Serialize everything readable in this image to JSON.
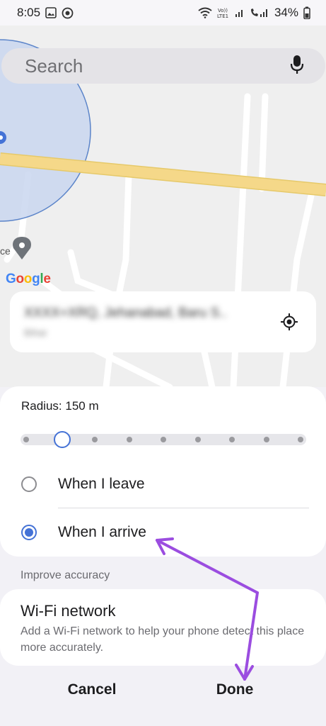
{
  "status_bar": {
    "time": "8:05",
    "battery": "34%"
  },
  "search": {
    "placeholder": "Search"
  },
  "map": {
    "attribution_letters": [
      "G",
      "o",
      "o",
      "g",
      "l",
      "e"
    ],
    "place_label_fragment": "ce"
  },
  "address_card": {
    "line1": "XXXX+XRQ, Jehanabad, Baru S..",
    "line2": "Bihar"
  },
  "radius": {
    "label": "Radius: 150 m",
    "steps": 9,
    "selected_step": 1
  },
  "trigger_options": [
    {
      "label": "When I leave",
      "selected": false
    },
    {
      "label": "When I arrive",
      "selected": true
    }
  ],
  "accuracy": {
    "heading": "Improve accuracy",
    "wifi_title": "Wi-Fi network",
    "wifi_description": "Add a Wi-Fi network to help your phone detect this place more accurately."
  },
  "buttons": {
    "cancel": "Cancel",
    "done": "Done"
  },
  "colors": {
    "accent": "#4472d6",
    "annotation_arrow": "#9b4de0",
    "road": "#f5d889",
    "radius_circle": "#c9d6ee"
  }
}
